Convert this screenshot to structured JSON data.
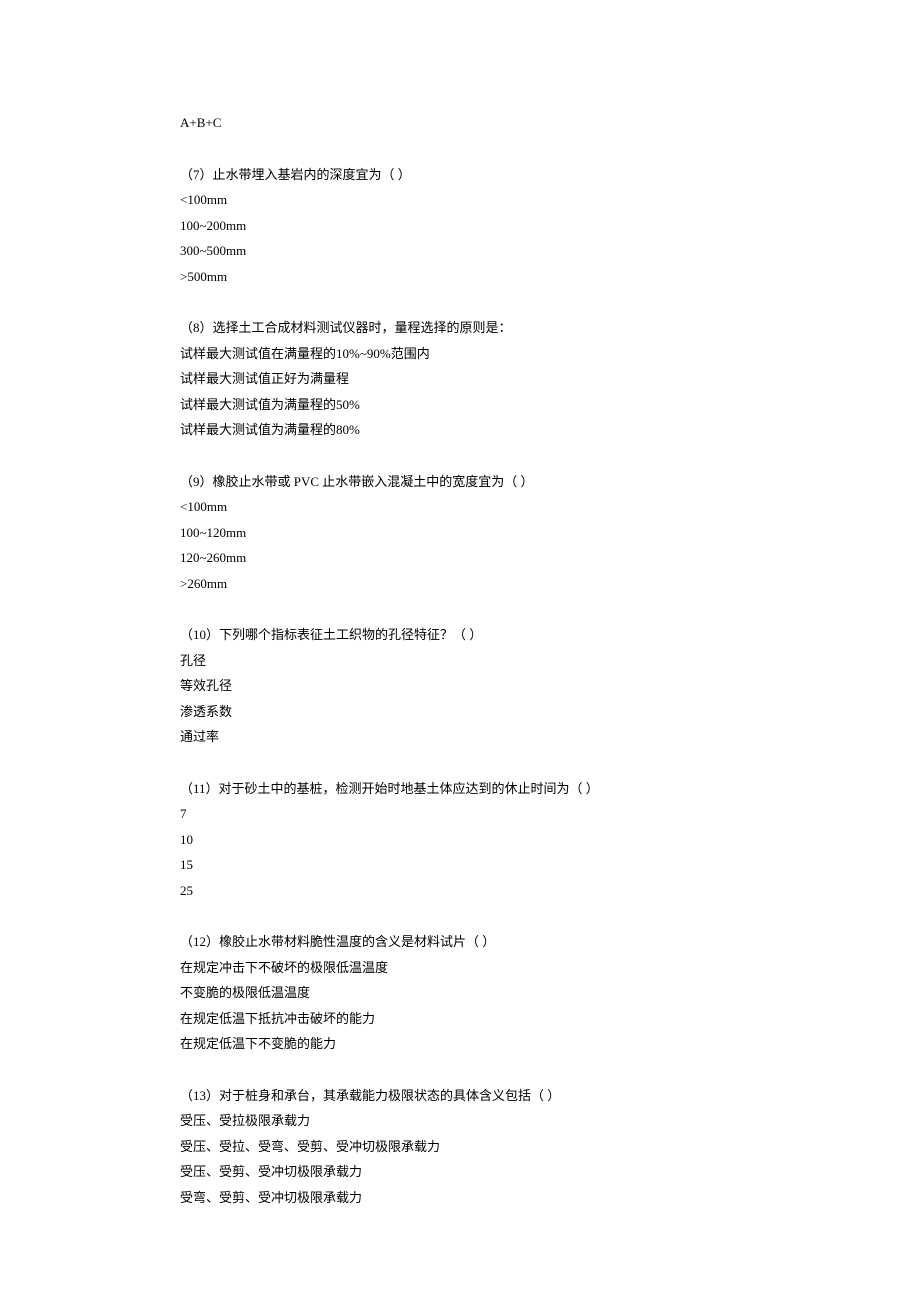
{
  "preamble": {
    "line": "A+B+C"
  },
  "questions": [
    {
      "prompt": "（7）止水带埋入基岩内的深度宜为（ ）",
      "options": [
        "<100mm",
        "100~200mm",
        "300~500mm",
        ">500mm"
      ]
    },
    {
      "prompt": "（8）选择土工合成材料测试仪器时，量程选择的原则是：",
      "options": [
        "试样最大测试值在满量程的10%~90%范围内",
        "试样最大测试值正好为满量程",
        "试样最大测试值为满量程的50%",
        "试样最大测试值为满量程的80%"
      ]
    },
    {
      "prompt": "（9）橡胶止水带或 PVC 止水带嵌入混凝土中的宽度宜为（ ）",
      "options": [
        "<100mm",
        "100~120mm",
        "120~260mm",
        ">260mm"
      ]
    },
    {
      "prompt": "（10）下列哪个指标表征土工织物的孔径特征？（ ）",
      "options": [
        "孔径",
        "等效孔径",
        "渗透系数",
        "通过率"
      ]
    },
    {
      "prompt": "（11）对于砂土中的基桩，检测开始时地基土体应达到的休止时间为（ ）",
      "options": [
        "7",
        "10",
        "15",
        "25"
      ]
    },
    {
      "prompt": "（12）橡胶止水带材料脆性温度的含义是材料试片（ ）",
      "options": [
        "在规定冲击下不破坏的极限低温温度",
        "不变脆的极限低温温度",
        "在规定低温下抵抗冲击破坏的能力",
        "在规定低温下不变脆的能力"
      ]
    },
    {
      "prompt": "（13）对于桩身和承台，其承载能力极限状态的具体含义包括（ ）",
      "options": [
        "受压、受拉极限承载力",
        "受压、受拉、受弯、受剪、受冲切极限承载力",
        "受压、受剪、受冲切极限承载力",
        "受弯、受剪、受冲切极限承载力"
      ]
    }
  ]
}
